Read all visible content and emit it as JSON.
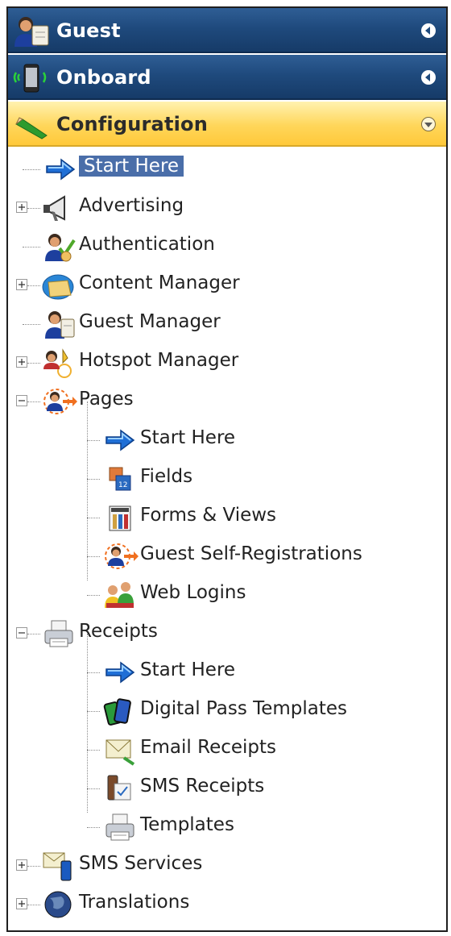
{
  "headers": [
    {
      "label": "Guest",
      "icon": "guest-icon",
      "state": "collapsed"
    },
    {
      "label": "Onboard",
      "icon": "phone-icon",
      "state": "collapsed"
    },
    {
      "label": "Configuration",
      "icon": "pencil-icon",
      "state": "expanded"
    }
  ],
  "tree": {
    "start_here": {
      "label": "Start Here",
      "icon": "arrow-right-icon",
      "selected": true
    },
    "advertising": {
      "label": "Advertising",
      "icon": "megaphone-icon"
    },
    "authentication": {
      "label": "Authentication",
      "icon": "user-check-icon"
    },
    "content_manager": {
      "label": "Content Manager",
      "icon": "folder-icon"
    },
    "guest_manager": {
      "label": "Guest Manager",
      "icon": "guest-manager-icon"
    },
    "hotspot_manager": {
      "label": "Hotspot Manager",
      "icon": "hotspot-icon"
    },
    "pages": {
      "label": "Pages",
      "icon": "person-arrow-icon",
      "children": [
        {
          "label": "Start Here",
          "icon": "arrow-right-icon"
        },
        {
          "label": "Fields",
          "icon": "fields-icon"
        },
        {
          "label": "Forms & Views",
          "icon": "forms-icon"
        },
        {
          "label": "Guest Self-Registrations",
          "icon": "person-arrow-icon"
        },
        {
          "label": "Web Logins",
          "icon": "people-icon"
        }
      ]
    },
    "receipts": {
      "label": "Receipts",
      "icon": "printer-icon",
      "children": [
        {
          "label": "Start Here",
          "icon": "arrow-right-icon"
        },
        {
          "label": "Digital Pass Templates",
          "icon": "cards-icon"
        },
        {
          "label": "Email Receipts",
          "icon": "envelope-icon"
        },
        {
          "label": "SMS Receipts",
          "icon": "sms-receipt-icon"
        },
        {
          "label": "Templates",
          "icon": "printer-icon"
        }
      ]
    },
    "sms_services": {
      "label": "SMS Services",
      "icon": "sms-envelope-icon"
    },
    "translations": {
      "label": "Translations",
      "icon": "globe-icon"
    }
  },
  "colors": {
    "header_blue": "#1f4a7d",
    "header_yellow": "#ffd65a",
    "selection": "#4a6ea9"
  }
}
